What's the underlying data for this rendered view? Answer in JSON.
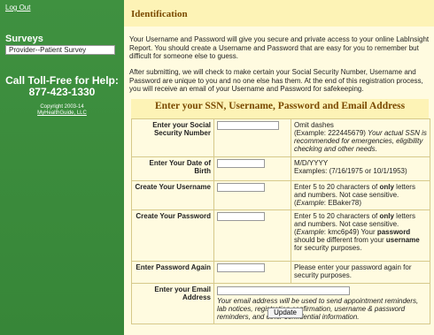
{
  "sidebar": {
    "logout": "Log Out",
    "surveys_title": "Surveys",
    "survey_item": "Provider--Patient Survey",
    "call_line1": "Call Toll-Free for Help:",
    "call_line2": "877-423-1330",
    "copyright_line1": "Copyright 2003-14",
    "copyright_line2": "MyHealthGuide, LLC"
  },
  "main": {
    "title": "Identification",
    "para1": "Your Username and Password will give you secure and private access to your online LabInsight Report.  You should create a Username and Password that are easy for you to remember but difficult for someone else to guess.",
    "para2": "After submitting, we will check to make certain your Social Security Number, Username and Password are unique to you and no one else has them.  At the end of this registration process, you will receive an email of your Username and Password for safekeeping."
  },
  "form": {
    "heading": "Enter your SSN, Username, Password and Email Address",
    "ssn": {
      "label": "Enter your Social Security Number",
      "note_a": "Omit dashes",
      "note_b": "(Example: 222445679) ",
      "note_c": "Your actual SSN is recommended for emergencies, eligibility checking and other needs."
    },
    "dob": {
      "label": "Enter  Your Date of Birth",
      "note_a": "M/D/YYYY",
      "note_b": "Examples: (7/16/1975 or 10/1/1953)"
    },
    "username": {
      "label": "Create Your Username",
      "note_a": "Enter 5 to 20 characters of ",
      "note_b": "only",
      "note_c": " letters and numbers. Not case sensitive. (",
      "note_d": "Example",
      "note_e": ": EBaker78)"
    },
    "password": {
      "label": "Create Your Password",
      "note_a": "Enter 5 to 20 characters of ",
      "note_b": "only",
      "note_c": " letters and numbers. Not case sensitive. (",
      "note_d": "Example",
      "note_e": ": kmc6p49) Your ",
      "note_f": "password",
      "note_g": " should be different from your ",
      "note_h": "username",
      "note_i": " for security purposes."
    },
    "password_again": {
      "label": "Enter Password Again",
      "note": "Please enter your password again for security purposes."
    },
    "email": {
      "label": "Enter your Email Address",
      "note": "Your email address will be used to send appointment reminders, lab notices, registration confirmation, username & password reminders, and other confidential information."
    },
    "update_label": "Update"
  }
}
